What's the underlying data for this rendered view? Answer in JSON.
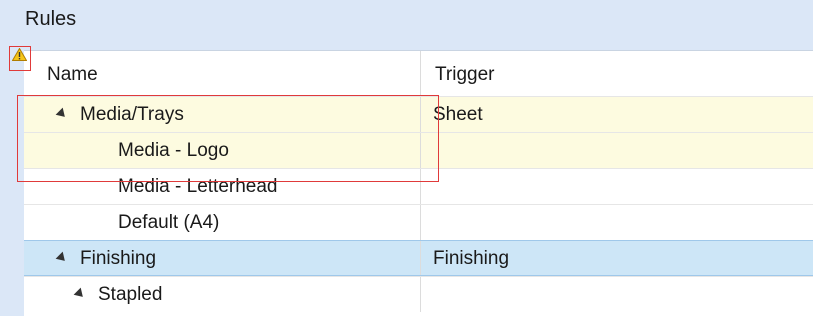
{
  "panel": {
    "title": "Rules"
  },
  "columns": {
    "name": "Name",
    "trigger": "Trigger"
  },
  "rows": [
    {
      "name": "Media/Trays",
      "trigger": "Sheet",
      "expanded": true,
      "state": "warning"
    },
    {
      "name": "Media - Logo",
      "trigger": "",
      "state": "warning"
    },
    {
      "name": "Media - Letterhead",
      "trigger": ""
    },
    {
      "name": "Default (A4)",
      "trigger": ""
    },
    {
      "name": "Finishing",
      "trigger": "Finishing",
      "expanded": true,
      "state": "selected"
    },
    {
      "name": "Stapled",
      "trigger": "",
      "expanded": true
    }
  ],
  "icons": {
    "warning": "warning-icon",
    "expander": "expanded-triangle-icon"
  },
  "colors": {
    "selection": "#cde6f7",
    "warning_row": "#fdfbe0",
    "annotation": "#e03a3a"
  }
}
